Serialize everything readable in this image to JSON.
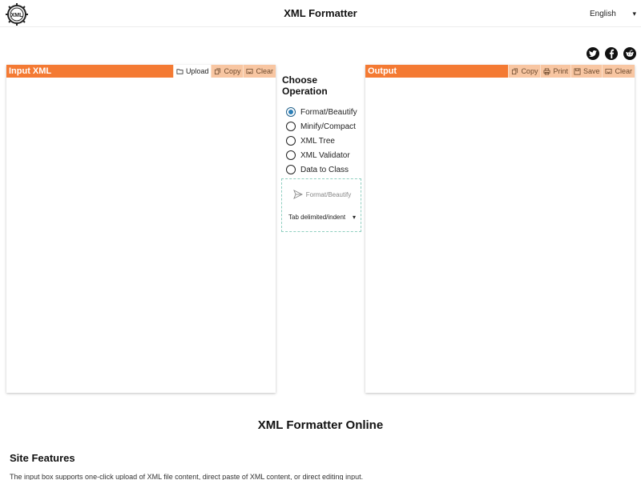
{
  "header": {
    "title": "XML Formatter",
    "logo_text": "XML",
    "language": "English"
  },
  "social": {
    "icons": [
      "twitter-icon",
      "facebook-icon",
      "reddit-icon"
    ]
  },
  "input_panel": {
    "title": "Input XML",
    "upload_label": "Upload",
    "copy_label": "Copy",
    "clear_label": "Clear",
    "value": ""
  },
  "operation": {
    "heading_line1": "Choose",
    "heading_line2": "Operation",
    "options": [
      {
        "label": "Format/Beautify",
        "checked": true
      },
      {
        "label": "Minify/Compact",
        "checked": false
      },
      {
        "label": "XML Tree",
        "checked": false
      },
      {
        "label": "XML Validator",
        "checked": false
      },
      {
        "label": "Data to Class",
        "checked": false
      }
    ],
    "run_label": "Format/Beautify",
    "indent_selected": "Tab delimited/indent"
  },
  "output_panel": {
    "title": "Output",
    "copy_label": "Copy",
    "print_label": "Print",
    "save_label": "Save",
    "clear_label": "Clear",
    "value": ""
  },
  "content": {
    "section_title": "XML Formatter Online",
    "features_title": "Site Features",
    "features_text": "The input box supports one-click upload of XML file content, direct paste of XML content, or direct editing input."
  },
  "colors": {
    "accent": "#f47a33",
    "button_bg": "#f8c6a2",
    "radio_checked": "#2b7fb8",
    "dashed_border": "#8fcfc0"
  }
}
